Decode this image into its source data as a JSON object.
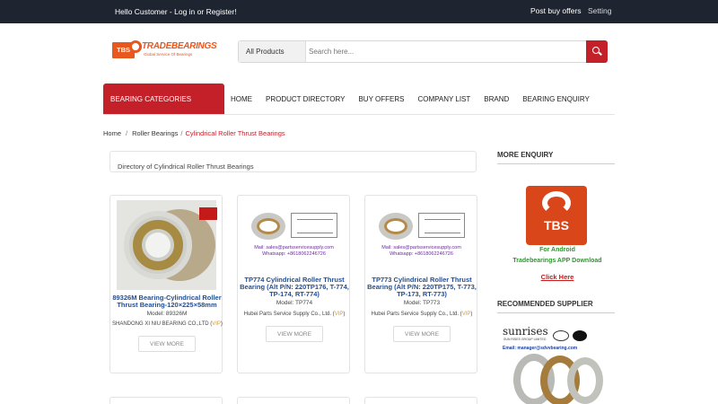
{
  "topbar": {
    "greeting": "Hello Customer - Log in or Register!",
    "post_buy_offers": "Post buy offers",
    "setting": "Setting"
  },
  "logo": {
    "mark": "TBS",
    "brand": "TRADEBEARINGS",
    "tagline": "Global Service Of Bearings"
  },
  "search": {
    "category_selected": "All Products",
    "placeholder": "Search here..."
  },
  "nav": {
    "categories_button": "BEARING CATEGORIES",
    "items": [
      {
        "label": "HOME"
      },
      {
        "label": "PRODUCT DIRECTORY"
      },
      {
        "label": "BUY OFFERS"
      },
      {
        "label": "COMPANY LIST"
      },
      {
        "label": "BRAND"
      },
      {
        "label": "BEARING ENQUIRY"
      }
    ]
  },
  "breadcrumb": {
    "home": "Home",
    "sep1": "/",
    "parent": "Roller Bearings",
    "sep2": "/",
    "current": "Cylindrical Roller Thrust Bearings"
  },
  "directory_title": "Directory of Cylindrical Roller Thrust Bearings",
  "products": [
    {
      "title": "89326M Bearing-Cylindrical Roller Thrust Bearing-120×225×58mm",
      "model": "Model: 89326M",
      "company": "SHANDONG XI NIU BEARING CO.,LTD",
      "vip": "VIP",
      "button": "VIEW MORE"
    },
    {
      "title": "TP774 Cylindrical Roller Thrust Bearing (Alt P/N: 220TP176, T-774, TP-174, RT-774)",
      "model": "Model: TP774",
      "company": "Hubei Parts Service Supply Co., Ltd.",
      "vip": "VIP",
      "button": "VIEW MORE",
      "img_email": "Mail: sales@partsservicesupply.com",
      "img_whatsapp": "Whatsapp: +8618062246726"
    },
    {
      "title": "TP773 Cylindrical Roller Thrust Bearing (Alt P/N: 220TP175, T-773, TP-173, RT-773)",
      "model": "Model: TP773",
      "company": "Hubei Parts Service Supply Co., Ltd.",
      "vip": "VIP",
      "button": "VIEW MORE",
      "img_email": "Mail: sales@partsservicesupply.com",
      "img_whatsapp": "Whatsapp: +8618062246726"
    }
  ],
  "sidebar": {
    "more_enquiry": "MORE ENQUIRY",
    "app_logo": "TBS",
    "app_line1": "For Android",
    "app_line2": "Tradebearings APP Download",
    "app_link": "Click Here",
    "recommended": "RECOMMENDED SUPPLIER",
    "supplier_name": "sunrises",
    "supplier_sub": "SUN RISES GROUP LIMITED",
    "supplier_mail": "Email: manager@sdvvbearing.com"
  }
}
